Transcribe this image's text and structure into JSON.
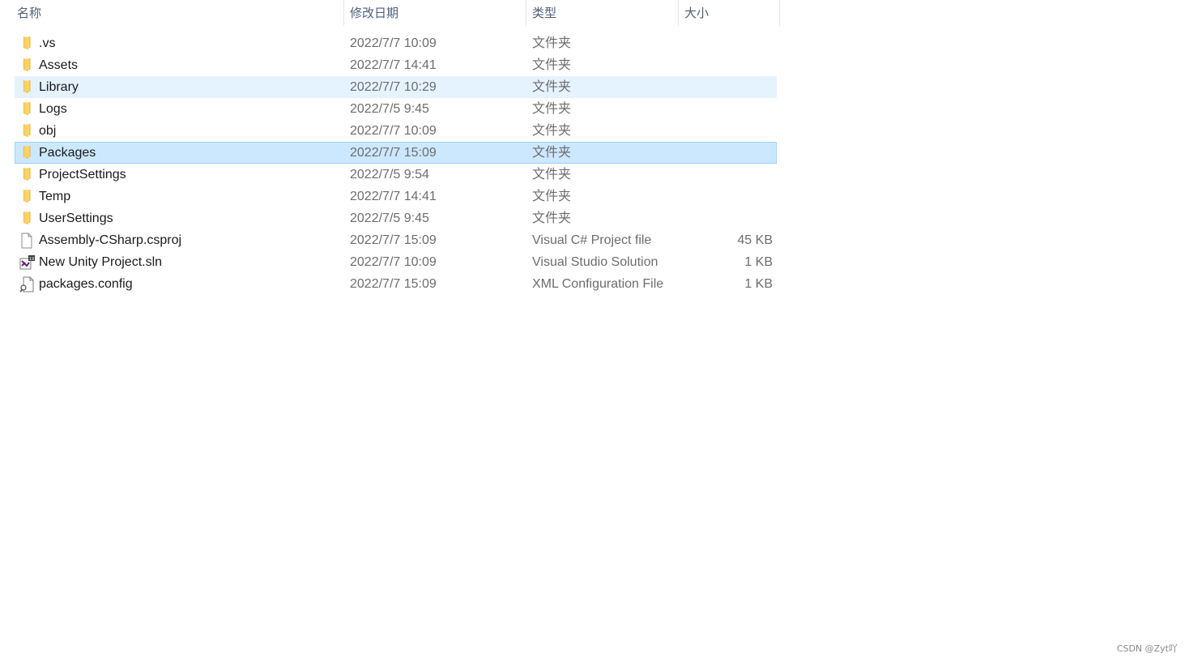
{
  "columns": {
    "name": "名称",
    "date": "修改日期",
    "type": "类型",
    "size": "大小"
  },
  "sort": {
    "column": "name",
    "direction": "ascending",
    "icon": "chevron-up-icon"
  },
  "files": [
    {
      "name": ".vs",
      "date": "2022/7/7 10:09",
      "type": "文件夹",
      "size": "",
      "icon": "folder-icon",
      "state": ""
    },
    {
      "name": "Assets",
      "date": "2022/7/7 14:41",
      "type": "文件夹",
      "size": "",
      "icon": "folder-icon",
      "state": ""
    },
    {
      "name": "Library",
      "date": "2022/7/7 10:29",
      "type": "文件夹",
      "size": "",
      "icon": "folder-icon",
      "state": "hover"
    },
    {
      "name": "Logs",
      "date": "2022/7/5 9:45",
      "type": "文件夹",
      "size": "",
      "icon": "folder-icon",
      "state": ""
    },
    {
      "name": "obj",
      "date": "2022/7/7 10:09",
      "type": "文件夹",
      "size": "",
      "icon": "folder-icon",
      "state": ""
    },
    {
      "name": "Packages",
      "date": "2022/7/7 15:09",
      "type": "文件夹",
      "size": "",
      "icon": "folder-icon",
      "state": "selected"
    },
    {
      "name": "ProjectSettings",
      "date": "2022/7/5 9:54",
      "type": "文件夹",
      "size": "",
      "icon": "folder-icon",
      "state": ""
    },
    {
      "name": "Temp",
      "date": "2022/7/7 14:41",
      "type": "文件夹",
      "size": "",
      "icon": "folder-icon",
      "state": ""
    },
    {
      "name": "UserSettings",
      "date": "2022/7/5 9:45",
      "type": "文件夹",
      "size": "",
      "icon": "folder-icon",
      "state": ""
    },
    {
      "name": "Assembly-CSharp.csproj",
      "date": "2022/7/7 15:09",
      "type": "Visual C# Project file",
      "size": "45 KB",
      "icon": "document-icon",
      "state": ""
    },
    {
      "name": "New Unity Project.sln",
      "date": "2022/7/7 10:09",
      "type": "Visual Studio Solution",
      "size": "1 KB",
      "icon": "visual-studio-solution-icon",
      "state": ""
    },
    {
      "name": "packages.config",
      "date": "2022/7/7 15:09",
      "type": "XML Configuration File",
      "size": "1 KB",
      "icon": "config-file-icon",
      "state": ""
    }
  ],
  "watermark": "CSDN @Zyt吖",
  "colors": {
    "hover_bg": "#e5f3ff",
    "selected_bg": "#cce8ff",
    "selected_border": "#99d1ff",
    "header_text": "#4c607a",
    "folder_yellow": "#ffd35c"
  }
}
